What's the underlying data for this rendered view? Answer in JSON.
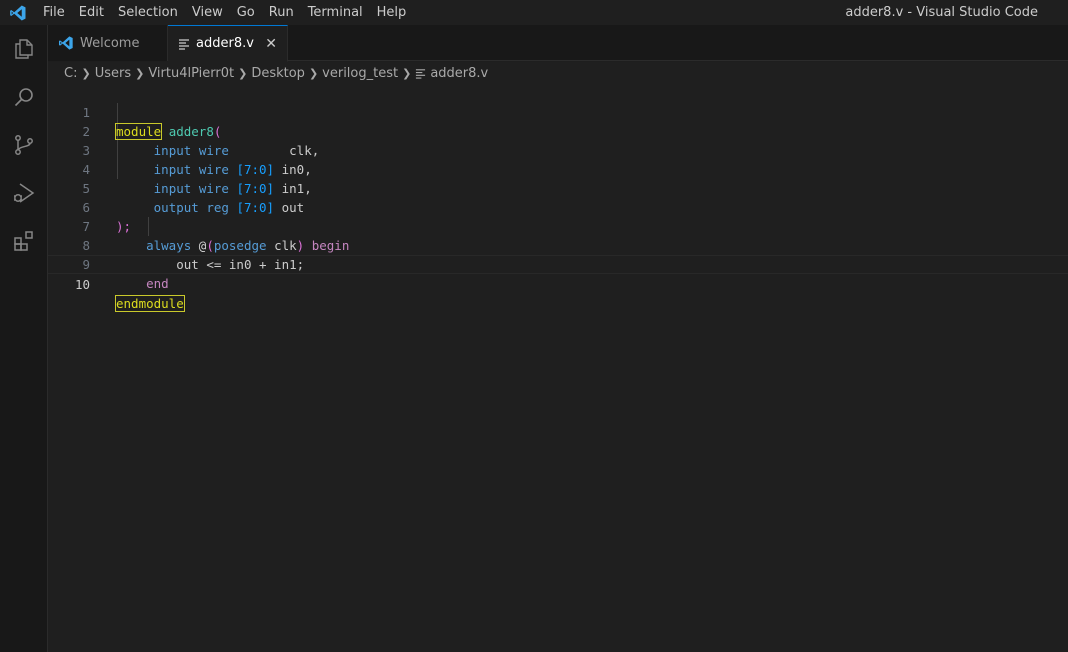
{
  "menu": [
    "File",
    "Edit",
    "Selection",
    "View",
    "Go",
    "Run",
    "Terminal",
    "Help"
  ],
  "window_title": "adder8.v - Visual Studio Code",
  "tabs": [
    {
      "label": "Welcome"
    },
    {
      "label": "adder8.v",
      "close": "✕"
    }
  ],
  "breadcrumb": [
    "C:",
    "Users",
    "Virtu4lPierr0t",
    "Desktop",
    "verilog_test",
    "adder8.v"
  ],
  "editor": {
    "line_numbers": [
      "1",
      "2",
      "3",
      "4",
      "5",
      "6",
      "7",
      "8",
      "9",
      "10"
    ],
    "current_line": "10",
    "code": {
      "l1": {
        "kw": "module",
        "name": "adder8",
        "paren": "("
      },
      "l2": {
        "dir": "input",
        "type": "wire",
        "pad": "       ",
        "sig": "clk,"
      },
      "l3": {
        "dir": "input",
        "type": "wire",
        "range": "[7:0]",
        "sig": "in0,"
      },
      "l4": {
        "dir": "input",
        "type": "wire",
        "range": "[7:0]",
        "sig": "in1,"
      },
      "l5": {
        "dir": "output",
        "type": "reg",
        "range": "[7:0]",
        "sig": "out"
      },
      "l6": {
        "close": ");"
      },
      "l7": {
        "kw": "always",
        "at": "@",
        "open": "(",
        "edge": "posedge",
        "sig": "clk",
        "close": ")",
        "begin": "begin"
      },
      "l8": {
        "stmt": "out <= in0 + in1;"
      },
      "l9": {
        "end": "end"
      },
      "l10": {
        "kw": "endmodule"
      }
    }
  },
  "icons": [
    "vscode-logo-icon",
    "explorer-icon",
    "search-icon",
    "source-control-icon",
    "run-debug-icon",
    "extensions-icon",
    "file-lines-icon",
    "close-icon",
    "chevron-right-icon"
  ]
}
